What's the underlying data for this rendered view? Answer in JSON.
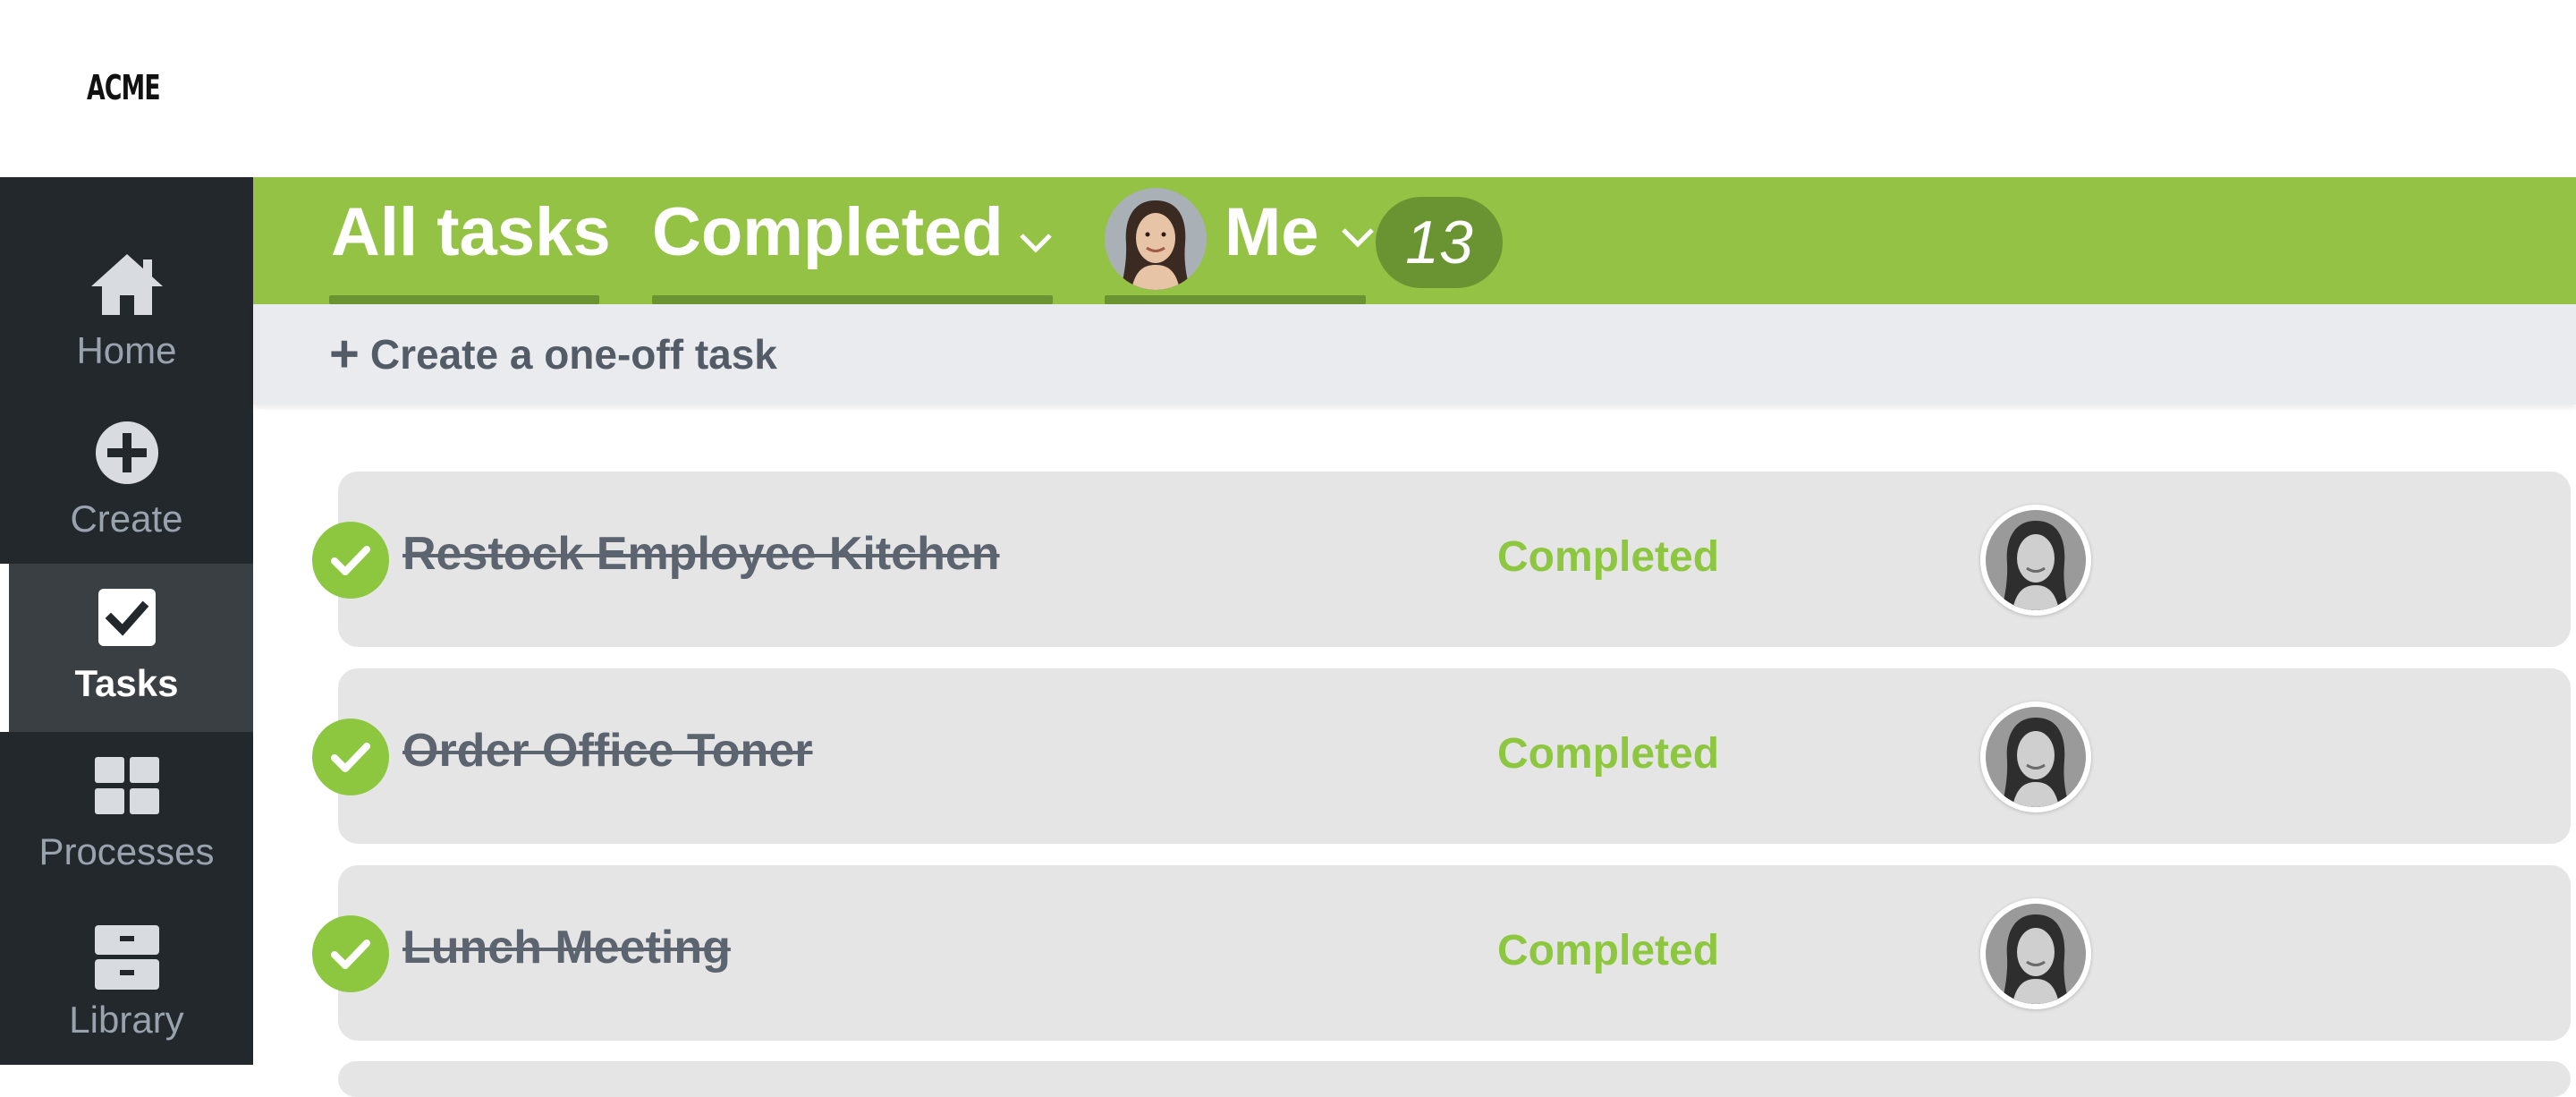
{
  "app": {
    "logo": "ACME"
  },
  "sidebar": {
    "items": [
      {
        "label": "Home",
        "icon": "home-icon",
        "active": false
      },
      {
        "label": "Create",
        "icon": "plus-circle-icon",
        "active": false
      },
      {
        "label": "Tasks",
        "icon": "checkbox-icon",
        "active": true
      },
      {
        "label": "Processes",
        "icon": "grid-icon",
        "active": false
      },
      {
        "label": "Library",
        "icon": "archive-drawer-icon",
        "active": false
      }
    ]
  },
  "header": {
    "filters": [
      {
        "label": "All tasks"
      },
      {
        "label": "Completed"
      },
      {
        "label": "Me"
      }
    ],
    "count": "13",
    "colors": {
      "bar": "#94c244",
      "accent_dark": "#6a9432"
    }
  },
  "create": {
    "label": "Create a one-off task",
    "icon": "plus-icon"
  },
  "tasks": [
    {
      "title": "Restock Employee Kitchen",
      "status": "Completed"
    },
    {
      "title": "Order Office Toner",
      "status": "Completed"
    },
    {
      "title": "Lunch Meeting",
      "status": "Completed"
    }
  ],
  "colors": {
    "sidebar_bg": "#23282d",
    "status_green": "#8dc63f"
  }
}
